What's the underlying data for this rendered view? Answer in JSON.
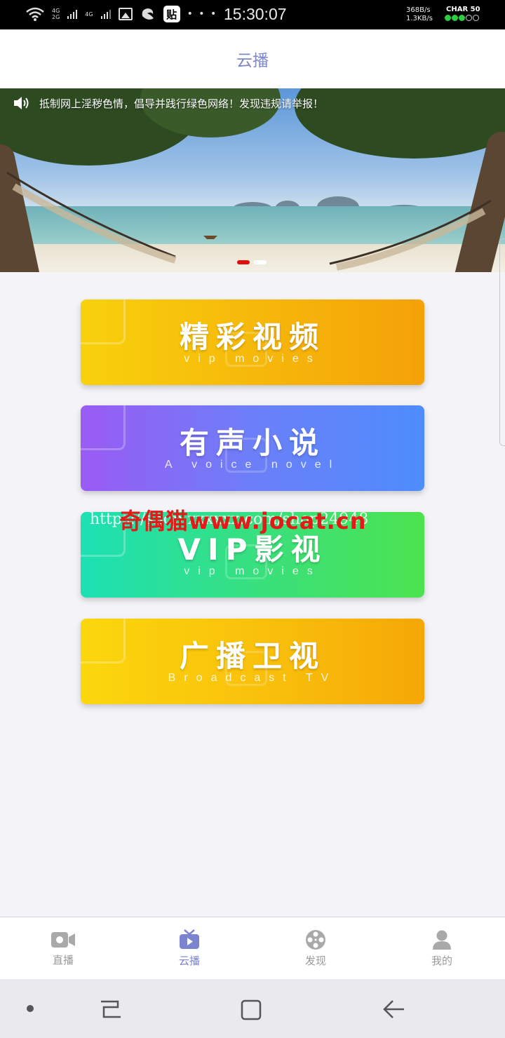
{
  "status_bar": {
    "net_4g_top": "4G",
    "net_2g": "2G",
    "net_4g_second": "4G",
    "sticker_badge": "贴",
    "more_dots": "• • •",
    "time": "15:30:07",
    "speed_up": "368B/s",
    "speed_down": "1.3KB/s",
    "charge_label": "CHAR 50",
    "battery_level": 0.6
  },
  "header": {
    "title": "云播"
  },
  "banner": {
    "notice": "抵制网上淫秽色情，倡导并践行绿色网络！发现违规请举报！",
    "slide_count": 2,
    "active_slide": 0
  },
  "menu": [
    {
      "title": "精彩视频",
      "subtitle": "vip movies"
    },
    {
      "title": "有声小说",
      "subtitle": "A voice novel"
    },
    {
      "title": "VIP影视",
      "subtitle": "vip movies"
    },
    {
      "title": "广播卫视",
      "subtitle": "Broadcast TV"
    }
  ],
  "watermark": {
    "url_text": "https://shop.xxxxxx.com/shop24948",
    "brand_text": "奇偶猫www.jocat.cn"
  },
  "tabs": [
    {
      "label": "直播",
      "icon": "video-camera-icon",
      "active": false
    },
    {
      "label": "云播",
      "icon": "tv-play-icon",
      "active": true
    },
    {
      "label": "发现",
      "icon": "film-reel-icon",
      "active": false
    },
    {
      "label": "我的",
      "icon": "user-icon",
      "active": false
    }
  ],
  "colors": {
    "header_title": "#7f88c9",
    "active_tab": "#7c83d0",
    "inactive_tab": "#9a9a9a",
    "active_dot": "#e01010"
  }
}
